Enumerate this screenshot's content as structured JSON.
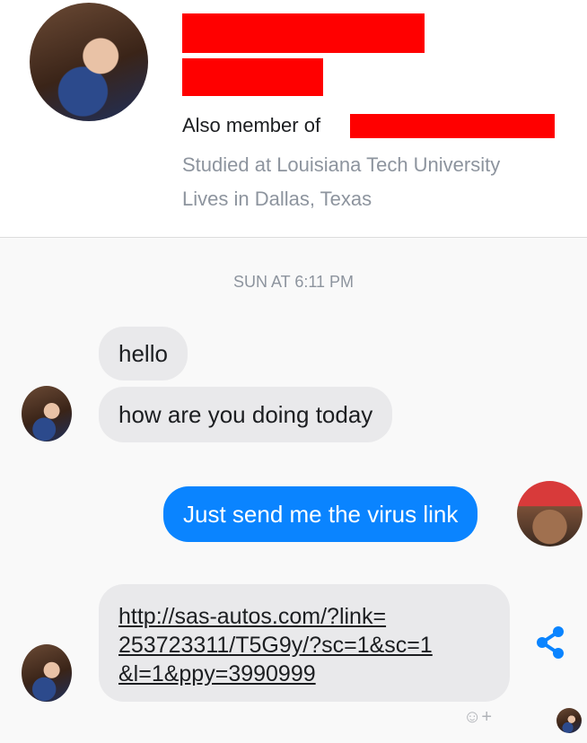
{
  "profile": {
    "also_member_of_label": "Also member of",
    "education": "Studied at Louisiana Tech University",
    "location": "Lives in Dallas, Texas"
  },
  "conversation": {
    "timestamp": "SUN AT 6:11 PM",
    "messages": [
      {
        "sender": "contact",
        "text": "hello"
      },
      {
        "sender": "contact",
        "text": "how are you doing today"
      },
      {
        "sender": "me",
        "text": "Just send me the virus link"
      }
    ],
    "link_message": {
      "sender": "contact",
      "lines": [
        "http://sas-autos.com/?link=",
        "253723311/T5G9y/?sc=1&sc=1",
        "&l=1&ppy=3990999"
      ]
    }
  },
  "icons": {
    "share": "share-icon",
    "emoji_add": "add-reaction-icon",
    "emoji_add_glyph": "☺+",
    "seen": "seen-avatar-icon"
  },
  "colors": {
    "outgoing_bubble": "#0a84ff",
    "incoming_bubble": "#e9e9eb",
    "redaction": "#ff0000",
    "share_icon": "#0a84ff"
  }
}
